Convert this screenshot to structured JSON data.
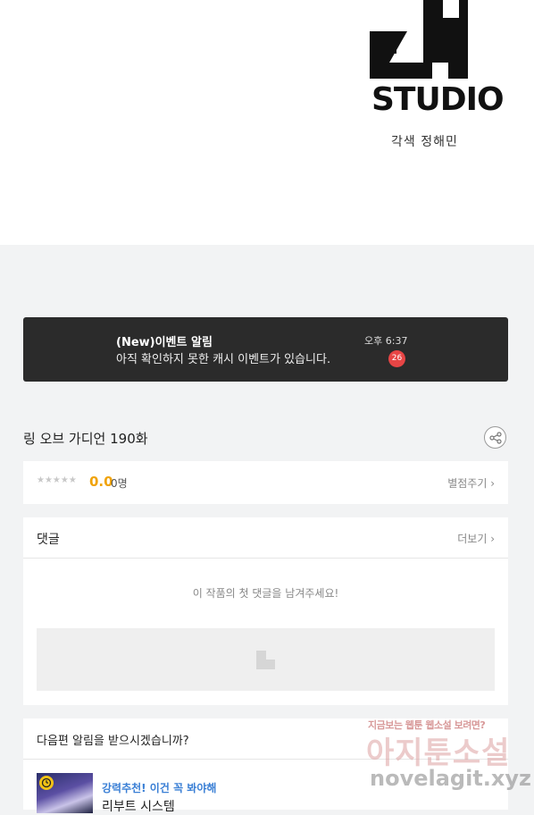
{
  "header": {
    "studio_name": "STUDIO",
    "credit": "각색 정해민"
  },
  "notification": {
    "title": "(New)이벤트 알림",
    "message": "아직 확인하지 못한 캐시 이벤트가 있습니다.",
    "time": "오후 6:37",
    "badge_count": "26"
  },
  "episode": {
    "title": "링 오브 가디언 190화",
    "share_icon": "share-icon"
  },
  "rating": {
    "stars": "★★★★★",
    "score": "0.0",
    "people": "0명",
    "rate_label": "별점주기 ›"
  },
  "comments": {
    "title": "댓글",
    "more_label": "더보기 ›",
    "empty_message": "이 작품의 첫 댓글을 남겨주세요!"
  },
  "next_alert": {
    "question": "다음편 알림을 받으시겠습니까?",
    "recommend_tag": "강력추천! 이건 꼭 봐야해",
    "recommend_title": "리부트 시스템"
  },
  "watermark": {
    "top": "지금보는 웹툰 웹소설 보려면?",
    "site_name": "아지툰소설",
    "url": "novelagit.xyz"
  },
  "colors": {
    "accent_score": "#f0a30a",
    "badge": "#e74545",
    "recommend": "#3a7fd5"
  }
}
